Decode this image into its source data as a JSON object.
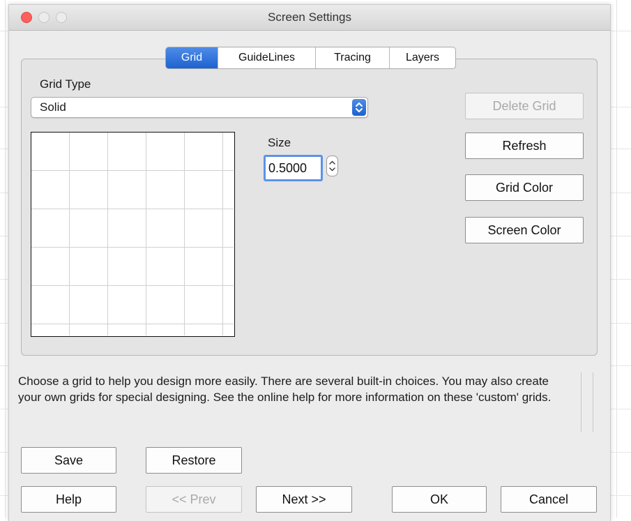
{
  "window": {
    "title": "Screen Settings"
  },
  "tabs": [
    {
      "label": "Grid",
      "active": true
    },
    {
      "label": "GuideLines",
      "active": false
    },
    {
      "label": "Tracing",
      "active": false
    },
    {
      "label": "Layers",
      "active": false
    }
  ],
  "grid_type": {
    "label": "Grid Type",
    "value": "Solid"
  },
  "size": {
    "label": "Size",
    "value": "0.5000"
  },
  "side_buttons": {
    "delete_grid": "Delete Grid",
    "refresh": "Refresh",
    "grid_color": "Grid Color",
    "screen_color": "Screen Color"
  },
  "help_text": "Choose a grid to help you design more easily. There are several built-in choices. You may also create your own grids for special designing. See the online help for more information on these 'custom' grids.",
  "footer": {
    "save": "Save",
    "restore": "Restore",
    "help": "Help",
    "prev": "<< Prev",
    "next": "Next >>",
    "ok": "OK",
    "cancel": "Cancel"
  },
  "colors": {
    "accent": "#1d62d0",
    "close_button": "#fc605c",
    "grid_line": "#d0d0d0",
    "focus_ring": "#5c93e6"
  },
  "icons": {
    "close": "close-icon",
    "minimize": "minimize-icon",
    "zoom": "zoom-icon",
    "select_arrows": "chevron-updown-icon",
    "stepper": "stepper-arrows-icon"
  }
}
